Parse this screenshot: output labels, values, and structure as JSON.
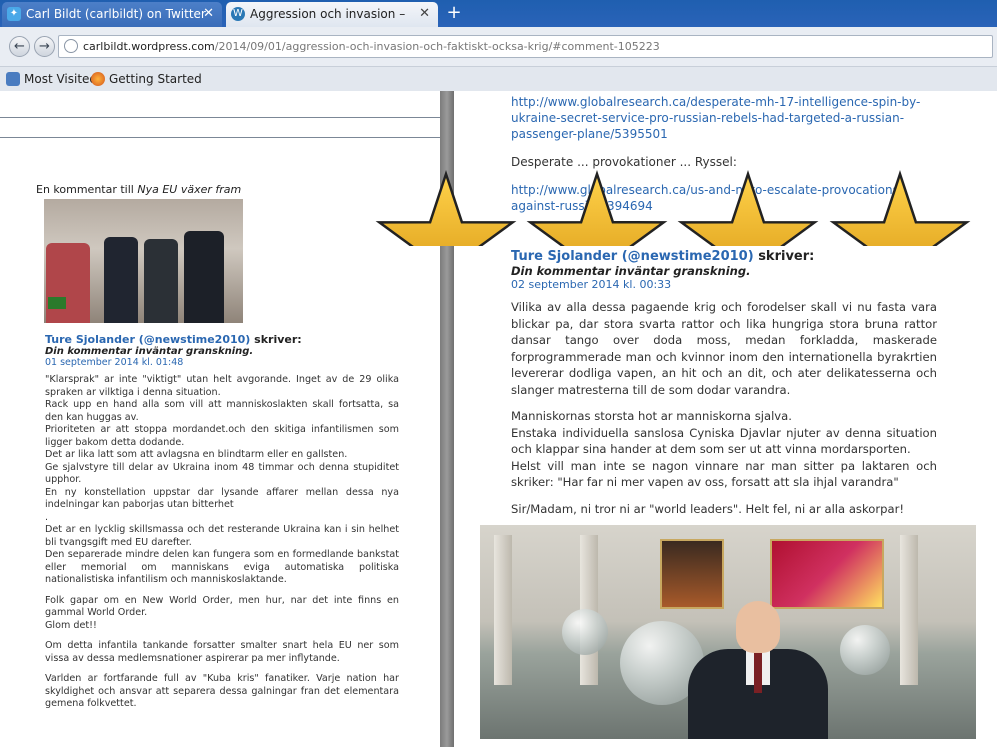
{
  "browser": {
    "tabs": [
      {
        "label": "Carl Bildt (carlbildt) on Twitter",
        "icon": "twitter-icon",
        "active": false
      },
      {
        "label": "Aggression och invasion – och...",
        "icon": "wordpress-icon",
        "active": true
      }
    ],
    "new_tab_symbol": "+",
    "close_symbol": "✕",
    "back_symbol": "←",
    "forward_symbol": "→",
    "url_domain": "carlbildt.wordpress.com",
    "url_path": "/2014/09/01/aggression-och-invasion-och-faktiskt-ocksa-krig/#comment-105223",
    "bookmarks": [
      "Most Visited",
      "Getting Started"
    ]
  },
  "left": {
    "caption_prefix": "En kommentar till ",
    "caption_title": "Nya EU växer fram",
    "author": "Ture Sjolander (@newstime2010)",
    "says": " skriver:",
    "moderation": "Din kommentar inväntar granskning.",
    "date": "01 september 2014 kl. 01:48",
    "paragraphs": [
      "\"Klarsprak\" ar inte \"viktigt\" utan helt avgorande. Inget av de 29 olika spraken ar vilktiga i denna situation.\nRack upp en hand alla som vill att manniskoslakten skall fortsatta, sa den kan huggas av.\nPrioriteten ar att stoppa mordandet.och den skitiga infantilismen som ligger bakom detta dodande.\nDet ar lika latt som att avlagsna en blindtarm eller en gallsten.\nGe sjalvstyre till delar av Ukraina inom 48 timmar och denna stupiditet upphor.\nEn ny konstellation uppstar dar lysande affarer mellan dessa nya indelningar kan paborjas utan bitterhet\n.\nDet ar en lycklig skillsmassa och det resterande Ukraina kan i sin helhet bli tvangsgift med EU darefter.\nDen separerade mindre delen kan fungera som en formedlande bankstat eller memorial om manniskans eviga automatiska politiska nationalistiska infantilism och manniskoslaktande.",
      "Folk gapar om en New World Order, men hur, nar det inte finns en gammal World Order.\nGlom det!!",
      "Om detta infantila tankande forsatter smalter snart hela EU ner som vissa av dessa medlemsnationer aspirerar pa mer inflytande.",
      "Varlden ar fortfarande full av \"Kuba kris\" fanatiker. Varje nation har skyldighet och ansvar att separera dessa galningar fran det elementara gemena folkvettet."
    ]
  },
  "right": {
    "link1": "http://www.globalresearch.ca/desperate-mh-17-intelligence-spin-by-ukraine-secret-service-pro-russian-rebels-had-targeted-a-russian-passenger-plane/5395501",
    "gray_line": "Desperate ... provokationer ... Ryssel:",
    "link2": "http://www.globalresearch.ca/us-and-nato-escalate-provocations-against-russia/5394694",
    "author": "Ture Sjolander (@newstime2010)",
    "says": " skriver:",
    "moderation": "Din kommentar inväntar granskning.",
    "date": "02 september 2014 kl. 00:33",
    "paragraphs": [
      "Vilika av alla dessa pagaende krig och forodelser skall vi nu fasta vara blickar pa, dar stora svarta rattor och lika hungriga stora bruna rattor dansar tango over doda moss, medan forkladda, maskerade forprogrammerade man och kvinnor inom den internationella byrakrtien levererar dodliga vapen, an hit och an dit, och ater delikatesserna och slanger matresterna till de som dodar varandra.",
      "Manniskornas storsta hot ar manniskorna sjalva.\nEnstaka individuella sanslosa Cyniska Djavlar njuter av denna situation och klappar sina hander at dem som ser ut att vinna mordarsporten.\nHelst vill man inte se nagon vinnare nar man sitter pa laktaren och skriker: \"Har far ni mer vapen av oss, forsatt att sla ihjal varandra\"",
      "Sir/Madam, ni tror ni ar \"world leaders\". Helt fel, ni ar alla askorpar!"
    ]
  },
  "colors": {
    "link": "#2a67b1",
    "star_fill": "#f0b422",
    "star_stroke": "#222222",
    "tab_bar": "#2a63b8"
  }
}
